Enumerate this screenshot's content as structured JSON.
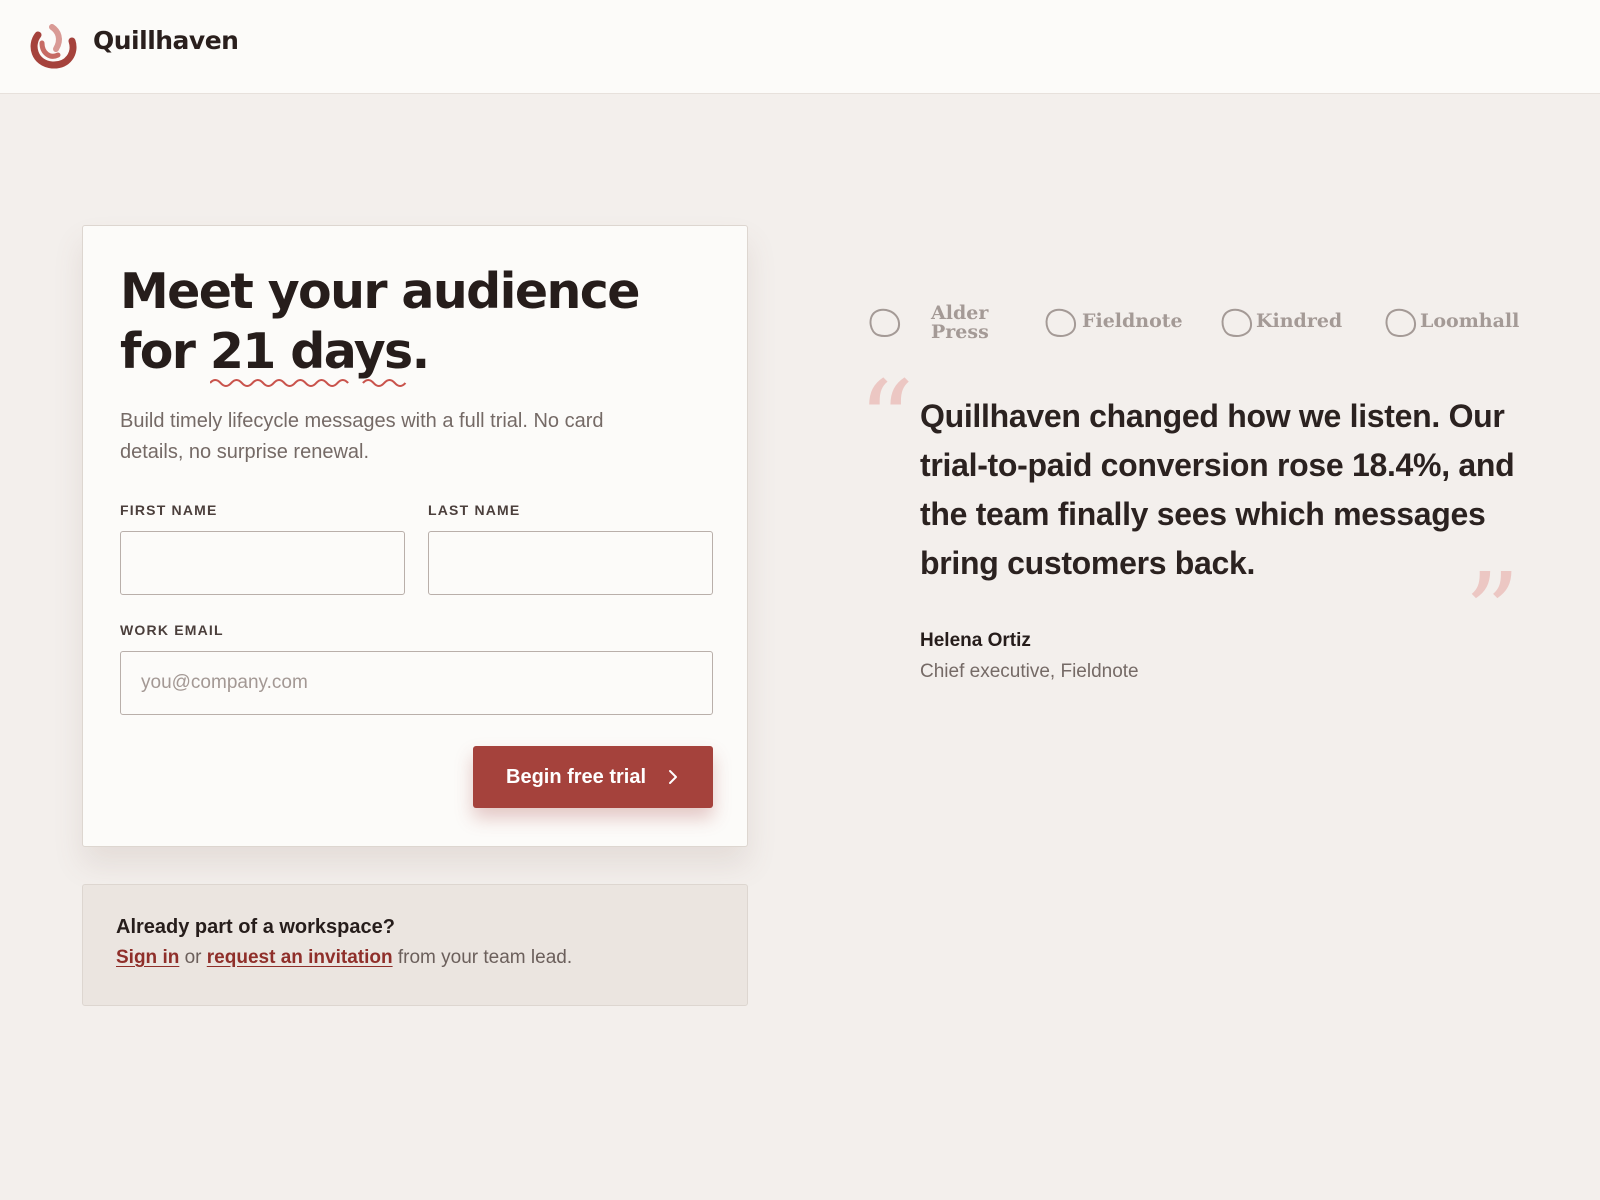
{
  "header": {
    "brand": "Quillhaven",
    "brand_colors": {
      "ring_dark": "#a5423c",
      "ring_light": "#d99a95"
    }
  },
  "signup_card": {
    "headline_line1": "Meet your audience",
    "headline_line2_prefix": "for ",
    "headline_highlight_1": "21",
    "headline_space": " ",
    "headline_highlight_2": "days",
    "headline_period": ".",
    "subtext": "Build timely lifecycle messages with a full trial. No card details, no surprise renewal.",
    "first_name": {
      "label": "FIRST NAME",
      "value": "",
      "placeholder": ""
    },
    "last_name": {
      "label": "LAST NAME",
      "value": "",
      "placeholder": ""
    },
    "work_email": {
      "label": "WORK EMAIL",
      "value": "",
      "placeholder": "you@company.com"
    },
    "cta_label": "Begin free trial",
    "cta_icon": "chevron-right-icon",
    "accent_color": "#a5423c"
  },
  "existing_workspace": {
    "title": "Already part of a workspace?",
    "sign_in": "Sign in",
    "or": " or ",
    "request_invite": "request an invitation",
    "suffix": " from your team lead."
  },
  "customer_logos": [
    {
      "name_line1": "Alder",
      "name_line2": "Press",
      "icon": "blob-icon"
    },
    {
      "name": "Fieldnote",
      "icon": "blob-icon"
    },
    {
      "name": "Kindred",
      "icon": "blob-icon"
    },
    {
      "name": "Loomhall",
      "icon": "blob-icon"
    }
  ],
  "testimonial": {
    "open_mark": "“",
    "close_mark": "”",
    "quote": "Quillhaven changed how we listen. Our trial-to-paid conversion rose 18.4%, and the team finally sees which messages bring customers back.",
    "author": "Helena Ortiz",
    "role": "Chief executive, Fieldnote"
  }
}
